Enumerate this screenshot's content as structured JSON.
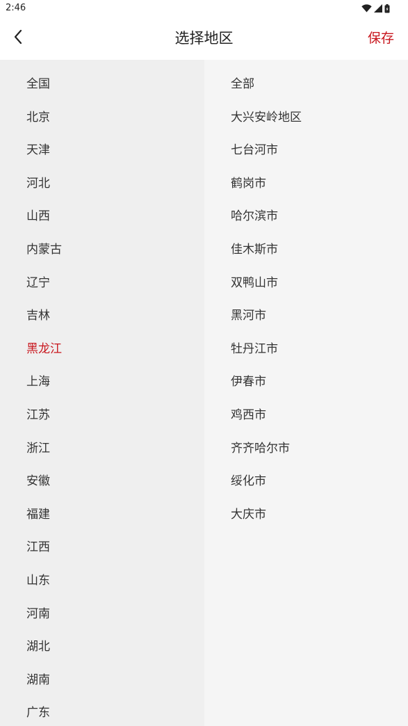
{
  "status_bar": {
    "time": "2:46",
    "icons": [
      "wifi-icon",
      "signal-icon",
      "battery-icon"
    ]
  },
  "header": {
    "back_icon": "chevron-left-icon",
    "title": "选择地区",
    "save_label": "保存"
  },
  "colors": {
    "accent": "#c8161d",
    "province_panel_bg": "#efefef",
    "city_panel_bg": "#f5f5f5",
    "text": "#333333"
  },
  "provinces": {
    "selected": "黑龙江",
    "items": [
      "全国",
      "北京",
      "天津",
      "河北",
      "山西",
      "内蒙古",
      "辽宁",
      "吉林",
      "黑龙江",
      "上海",
      "江苏",
      "浙江",
      "安徽",
      "福建",
      "江西",
      "山东",
      "河南",
      "湖北",
      "湖南",
      "广东"
    ]
  },
  "cities": {
    "items": [
      "全部",
      "大兴安岭地区",
      "七台河市",
      "鹤岗市",
      "哈尔滨市",
      "佳木斯市",
      "双鸭山市",
      "黑河市",
      "牡丹江市",
      "伊春市",
      "鸡西市",
      "齐齐哈尔市",
      "绥化市",
      "大庆市"
    ]
  }
}
